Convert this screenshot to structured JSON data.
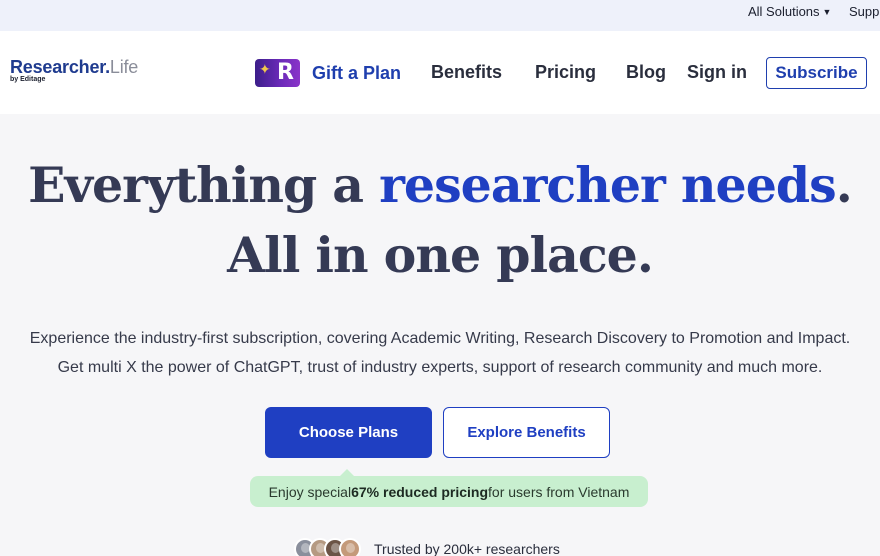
{
  "utility_bar": {
    "all_solutions": "All Solutions",
    "support": "Supp"
  },
  "logo": {
    "brand_a": "Researcher.",
    "brand_b": "Life",
    "sub": "by Editage"
  },
  "nav": {
    "gift_icon_letter": "R",
    "gift_label": "Gift a Plan",
    "benefits": "Benefits",
    "pricing": "Pricing",
    "blog": "Blog",
    "sign_in": "Sign in",
    "subscribe": "Subscribe"
  },
  "hero": {
    "title_part1": "Everything a ",
    "title_accent": "researcher needs",
    "title_period": ".",
    "title_line2": "All in one place.",
    "desc_line1": "Experience the industry-first subscription, covering Academic Writing, Research Discovery to Promotion and Impact.",
    "desc_line2": "Get multi X the power of ChatGPT, trust of industry experts, support of research community and much more."
  },
  "cta": {
    "choose_plans": "Choose Plans",
    "explore_benefits": "Explore Benefits"
  },
  "promo": {
    "prefix": "Enjoy special ",
    "highlight": "67% reduced pricing",
    "suffix": " for users from Vietnam"
  },
  "trusted": {
    "text": "Trusted by 200k+ researchers"
  },
  "colors": {
    "accent": "#1f3fc2",
    "promo_bg": "#c8efcf",
    "avatars": [
      "#8a8f9c",
      "#b59a82",
      "#6b5446",
      "#c49a7a"
    ]
  }
}
